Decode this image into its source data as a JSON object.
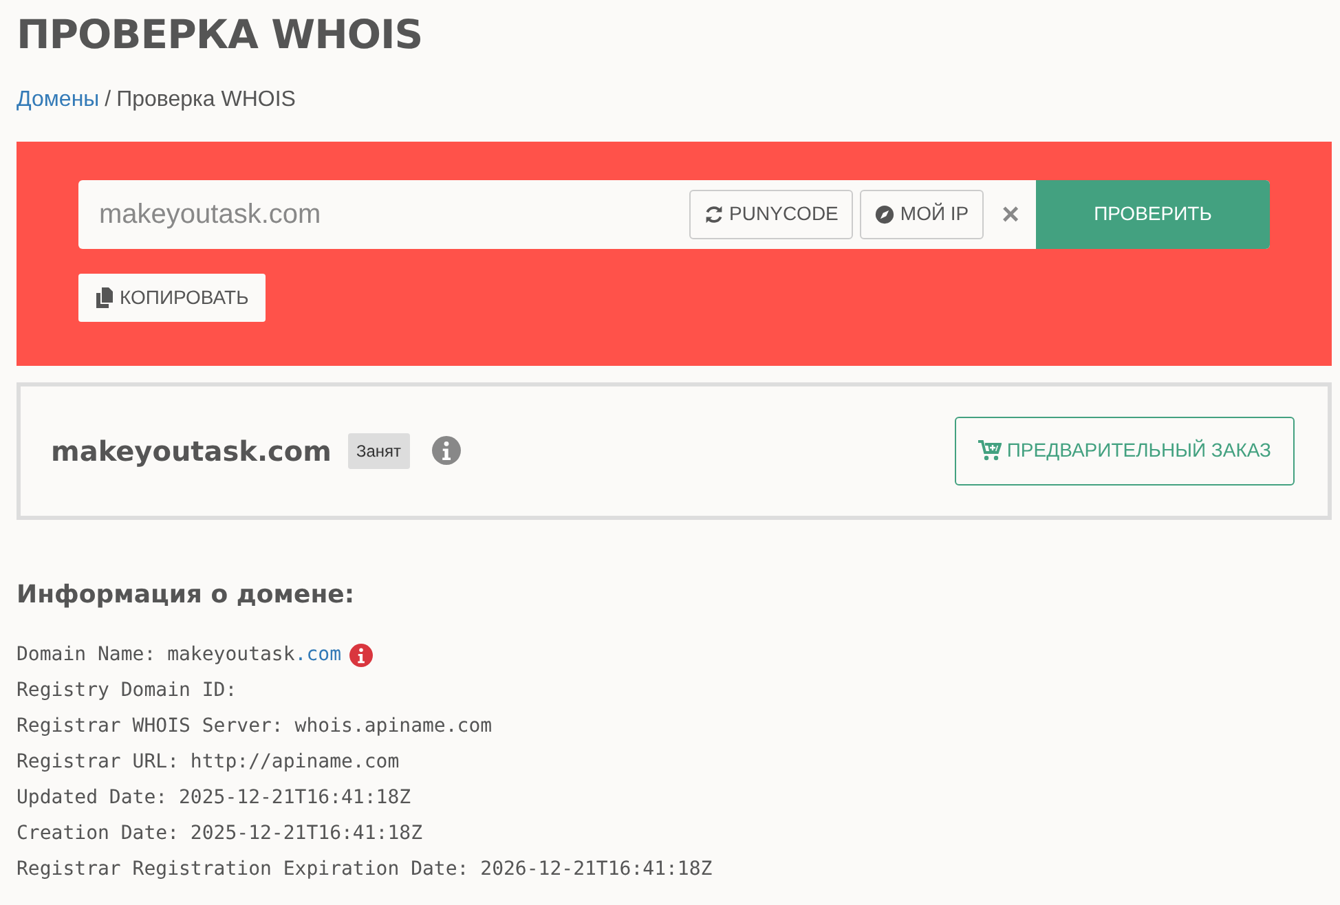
{
  "page_title": "ПРОВЕРКА WHOIS",
  "breadcrumb": [
    {
      "label": "Домены",
      "kind": "link"
    },
    {
      "label": "/",
      "kind": "separator"
    },
    {
      "label": "Проверка WHOIS",
      "kind": "current"
    }
  ],
  "search": {
    "value": "makeyoutask.com",
    "buttons": [
      {
        "label": "PUNYCODE"
      },
      {
        "label": "МОЙ IP"
      }
    ],
    "clear": "×",
    "submit": "ПРОВЕРИТЬ",
    "copy": "КОПИРОВАТЬ"
  },
  "result": {
    "domain": "makeyoutask.com",
    "status": "Занят",
    "order_button": "ПРЕДВАРИТЕЛЬНЫЙ ЗАКАЗ"
  },
  "info_heading": "Информация о домене:",
  "whois_lines": [
    {
      "text": "Domain Name: makeyoutask",
      "link": ".com",
      "warning": true
    },
    {
      "text": "Registry Domain ID:",
      "warning": false
    },
    {
      "text": "Registrar WHOIS Server: whois.apiname.com",
      "warning": false
    },
    {
      "text": "Registrar URL: http://apiname.com",
      "warning": false
    },
    {
      "text": "Updated Date: 2025-12-21T16:41:18Z",
      "warning": false
    },
    {
      "text": "Creation Date: 2025-12-21T16:41:18Z",
      "warning": false
    },
    {
      "text": "Registrar Registration Expiration Date: 2026-12-21T16:41:18Z",
      "warning": false
    }
  ]
}
